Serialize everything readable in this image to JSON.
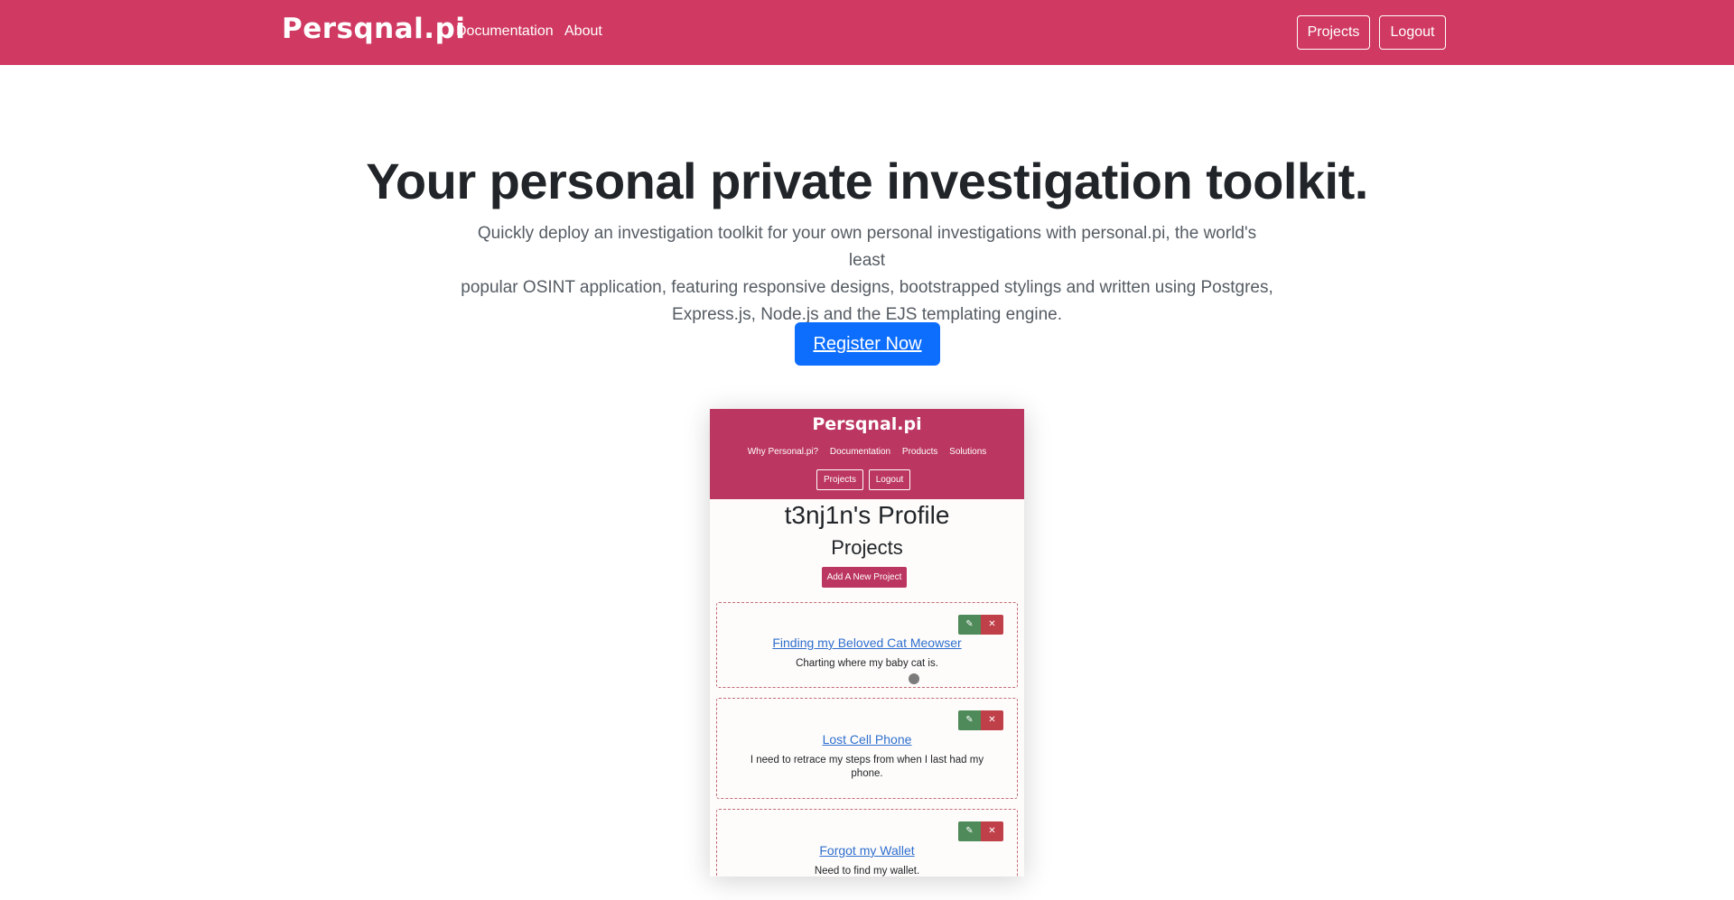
{
  "navbar": {
    "brand": "Persqnal.pi",
    "links": [
      "Documentation",
      "About"
    ],
    "buttons": {
      "projects": "Projects",
      "logout": "Logout"
    },
    "color": "#d03a62"
  },
  "hero": {
    "title": "Your personal private investigation toolkit.",
    "lines": [
      "Quickly deploy an investigation toolkit for your own personal investigations with personal.pi, the world's least",
      "popular OSINT application, featuring responsive designs, bootstrapped stylings and written using Postgres,",
      "Express.js, Node.js and the EJS templating engine."
    ],
    "cta": "Register Now",
    "cta_color": "#0d6efd"
  },
  "preview": {
    "brand": "Persqnal.pi",
    "links": [
      "Why Personal.pi?",
      "Documentation",
      "Products",
      "Solutions"
    ],
    "buttons": {
      "projects": "Projects",
      "logout": "Logout"
    },
    "title": "t3nj1n's Profile",
    "subtitle": "Projects",
    "add_button": "Add A New Project",
    "edit_icon": "✎",
    "delete_icon": "✕",
    "projects": [
      {
        "name": "Finding my Beloved Cat Meowser",
        "desc": "Charting where my baby cat is."
      },
      {
        "name": "Lost Cell Phone",
        "desc": "I need to retrace my steps from when I last had my phone."
      },
      {
        "name": "Forgot my Wallet",
        "desc": "Need to find my wallet."
      }
    ]
  }
}
